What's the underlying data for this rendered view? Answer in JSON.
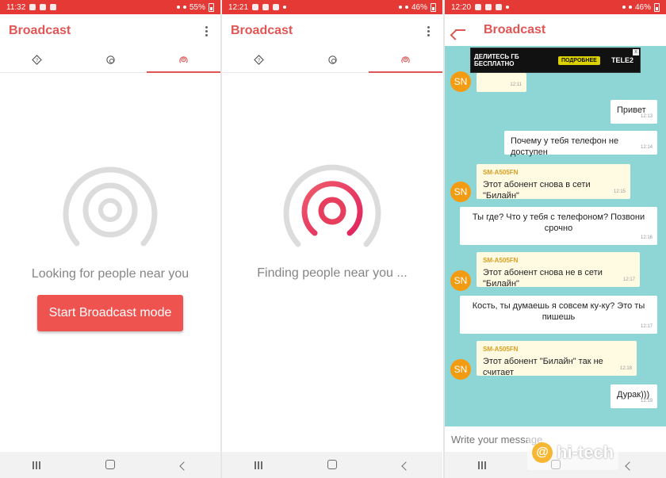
{
  "screen1": {
    "status": {
      "time": "11:32",
      "battery": "55%"
    },
    "title": "Broadcast",
    "caption": "Looking for people near you",
    "start_button": "Start Broadcast mode"
  },
  "screen2": {
    "status": {
      "time": "12:21",
      "battery": "46%"
    },
    "title": "Broadcast",
    "caption": "Finding people near you ..."
  },
  "screen3": {
    "status": {
      "time": "12:20",
      "battery": "46%"
    },
    "title": "Broadcast",
    "ad": {
      "text": "ДЕЛИТЕСЬ ГБ БЕСПЛАТНО",
      "button": "ПОДРОБНЕЕ",
      "brand": "TELE2"
    },
    "avatar_initials": "SN",
    "messages": [
      {
        "type": "in",
        "sender": "",
        "text": "",
        "time": "12:11"
      },
      {
        "type": "out",
        "text": "Привет",
        "time": "12:13"
      },
      {
        "type": "out",
        "text": "Почему у тебя телефон не доступен",
        "time": "12:14"
      },
      {
        "type": "in",
        "sender": "SM-A505FN",
        "text": "Этот абонент снова в сети \"Билайн\"",
        "time": "12:15"
      },
      {
        "type": "out",
        "text": "Ты где? Что у тебя с телефоном? Позвони срочно",
        "time": "12:16"
      },
      {
        "type": "in",
        "sender": "SM-A505FN",
        "text": "Этот абонент снова не в сети \"Билайн\"",
        "time": "12:17"
      },
      {
        "type": "out",
        "text": "Кость, ты думаешь я совсем ку-ку? Это ты пишешь",
        "time": "12:17"
      },
      {
        "type": "in",
        "sender": "SM-A505FN",
        "text": "Этот абонент \"Билайн\" так не считает",
        "time": "12:18"
      },
      {
        "type": "out",
        "text": "Дурак)))",
        "time": "12:19"
      }
    ],
    "input_placeholder": "Write your message",
    "watermark": "hi-tech"
  },
  "colors": {
    "accent": "#e25555",
    "status_bar": "#e53935",
    "chat_bg": "#8ed5d5",
    "avatar": "#f39c12"
  }
}
